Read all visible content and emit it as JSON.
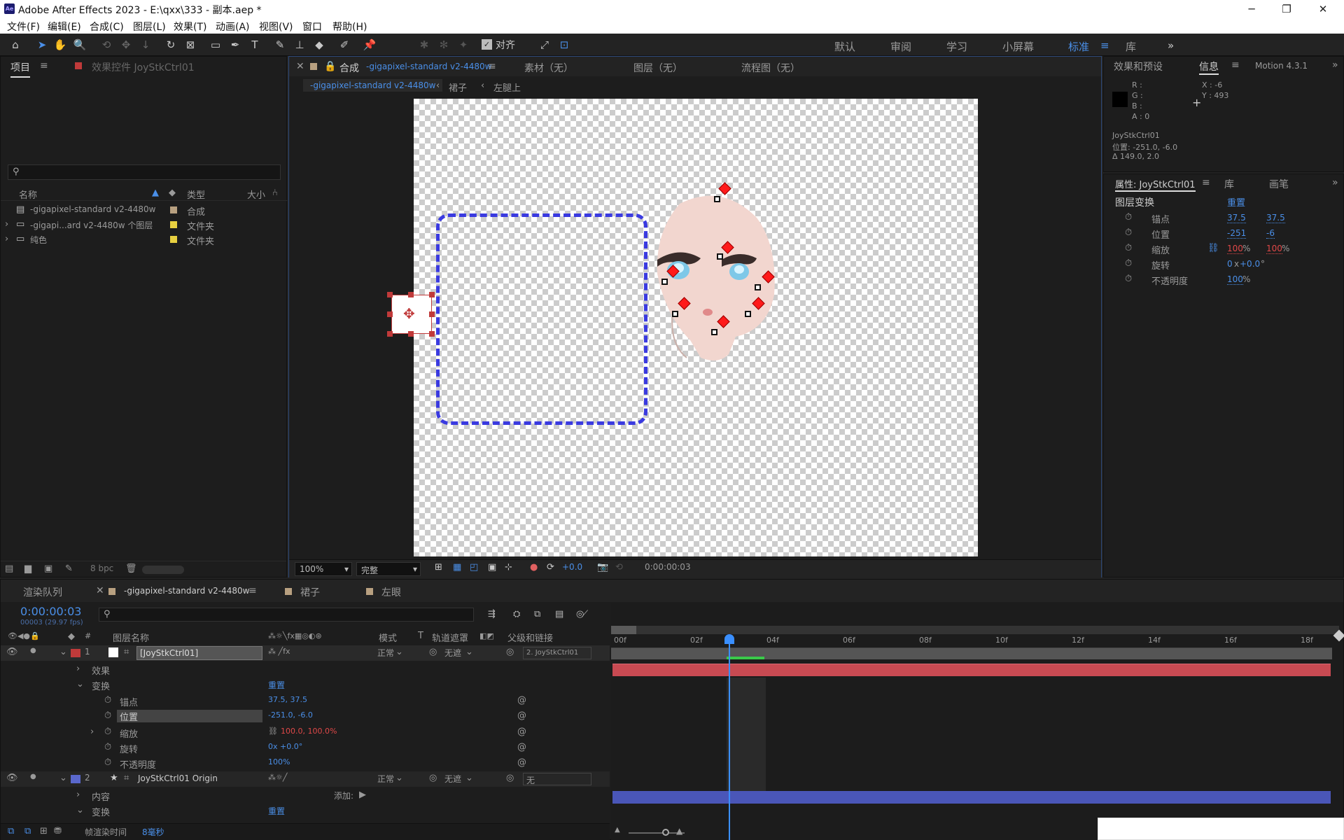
{
  "app": {
    "title": "Adobe After Effects 2023 - E:\\qxx\\333 - 副本.aep *",
    "icon_text": "Ae"
  },
  "menu": [
    "文件(F)",
    "编辑(E)",
    "合成(C)",
    "图层(L)",
    "效果(T)",
    "动画(A)",
    "视图(V)",
    "窗口",
    "帮助(H)"
  ],
  "toolbar": {
    "align_label": "对齐",
    "workspaces": [
      "默认",
      "审阅",
      "学习",
      "小屏幕",
      "标准",
      "库"
    ],
    "active_workspace": "标准"
  },
  "project": {
    "tab": "项目",
    "effects_tab": "效果控件 JoyStkCtrl01",
    "search_placeholder": "",
    "cols": [
      "名称",
      "类型",
      "大小"
    ],
    "items": [
      {
        "name": "-gigapixel-standard v2-4480w",
        "type": "合成",
        "color": "#b8a080"
      },
      {
        "name": "-gigapi...ard v2-4480w 个图层",
        "type": "文件夹",
        "color": "#e8d040"
      },
      {
        "name": "纯色",
        "type": "文件夹",
        "color": "#e8d040"
      }
    ],
    "bpc": "8 bpc"
  },
  "comp": {
    "tab_prefix": "合成",
    "tab_name": "-gigapixel-standard v2-4480w",
    "other_tabs": [
      "素材（无）",
      "图层（无）",
      "流程图（无）"
    ],
    "breadcrumb": [
      "-gigapixel-standard v2-4480w",
      "裙子",
      "左腿上"
    ],
    "zoom": "100%",
    "quality": "完整",
    "exposure": "+0.0",
    "timecode": "0:00:00:03"
  },
  "info": {
    "tab_effects": "效果和预设",
    "tab_info": "信息",
    "motion": "Motion 4.3.1",
    "rgba": [
      "R :",
      "G :",
      "B :",
      "A : 0"
    ],
    "x": "X : -6",
    "y": "Y : 493",
    "layer": "JoyStkCtrl01",
    "pos": "位置: -251.0, -6.0",
    "delta": "Δ 149.0, 2.0"
  },
  "props": {
    "tab": "属性: JoyStkCtrl01",
    "tab_lib": "库",
    "tab_brush": "画笔",
    "section": "图层变换",
    "reset": "重置",
    "rows": [
      {
        "label": "锚点",
        "v1": "37.5",
        "v2": "37.5",
        "unit": ""
      },
      {
        "label": "位置",
        "v1": "-251",
        "v2": "-6",
        "unit": ""
      },
      {
        "label": "缩放",
        "v1": "100",
        "v2": "100",
        "unit": "%"
      },
      {
        "label": "旋转",
        "v1": "0",
        "v2": "+0.0",
        "unit": "°"
      },
      {
        "label": "不透明度",
        "v1": "100",
        "v2": "",
        "unit": "%"
      }
    ],
    "rot_x": "x"
  },
  "timeline": {
    "tabs": [
      "渲染队列",
      "-gigapixel-standard v2-4480w",
      "裙子",
      "左眼"
    ],
    "timecode": "0:00:00:03",
    "fps": "00003 (29.97 fps)",
    "headers": {
      "name": "图层名称",
      "mode": "模式",
      "t": "T",
      "track": "轨道遮罩",
      "parent": "父级和链接"
    },
    "ruler": [
      "00f",
      "02f",
      "04f",
      "06f",
      "08f",
      "10f",
      "12f",
      "14f",
      "16f",
      "18f"
    ],
    "layer1": {
      "num": "1",
      "name": "[JoyStkCtrl01]",
      "mode": "正常",
      "track": "无遮",
      "parent": "2. JoyStkCtrl01"
    },
    "effects": "效果",
    "transform": "变换",
    "reset": "重置",
    "transform_rows": [
      {
        "label": "锚点",
        "value": "37.5, 37.5"
      },
      {
        "label": "位置",
        "value": "-251.0, -6.0"
      },
      {
        "label": "缩放",
        "value": "100.0, 100.0%"
      },
      {
        "label": "旋转",
        "value": "0x +0.0°"
      },
      {
        "label": "不透明度",
        "value": "100%"
      }
    ],
    "layer2": {
      "num": "2",
      "name": "JoyStkCtrl01 Origin",
      "mode": "正常",
      "track": "无遮",
      "parent": "无"
    },
    "content": "内容",
    "add": "添加:",
    "transform2": "变换",
    "reset2": "重置",
    "footer": {
      "label": "帧渲染时间",
      "value": "8毫秒"
    }
  },
  "colors": {
    "layer1": "#c03a3a",
    "layer2": "#5a68cc",
    "accent": "#4a8fe8"
  }
}
